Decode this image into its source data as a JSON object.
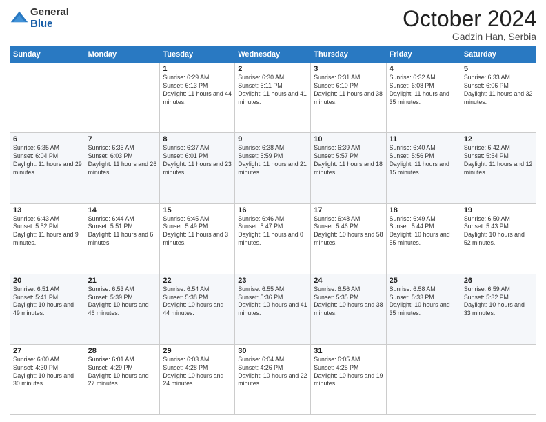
{
  "logo": {
    "general": "General",
    "blue": "Blue"
  },
  "title": {
    "month": "October 2024",
    "location": "Gadzin Han, Serbia"
  },
  "headers": [
    "Sunday",
    "Monday",
    "Tuesday",
    "Wednesday",
    "Thursday",
    "Friday",
    "Saturday"
  ],
  "weeks": [
    [
      {
        "day": "",
        "sunrise": "",
        "sunset": "",
        "daylight": ""
      },
      {
        "day": "",
        "sunrise": "",
        "sunset": "",
        "daylight": ""
      },
      {
        "day": "1",
        "sunrise": "Sunrise: 6:29 AM",
        "sunset": "Sunset: 6:13 PM",
        "daylight": "Daylight: 11 hours and 44 minutes."
      },
      {
        "day": "2",
        "sunrise": "Sunrise: 6:30 AM",
        "sunset": "Sunset: 6:11 PM",
        "daylight": "Daylight: 11 hours and 41 minutes."
      },
      {
        "day": "3",
        "sunrise": "Sunrise: 6:31 AM",
        "sunset": "Sunset: 6:10 PM",
        "daylight": "Daylight: 11 hours and 38 minutes."
      },
      {
        "day": "4",
        "sunrise": "Sunrise: 6:32 AM",
        "sunset": "Sunset: 6:08 PM",
        "daylight": "Daylight: 11 hours and 35 minutes."
      },
      {
        "day": "5",
        "sunrise": "Sunrise: 6:33 AM",
        "sunset": "Sunset: 6:06 PM",
        "daylight": "Daylight: 11 hours and 32 minutes."
      }
    ],
    [
      {
        "day": "6",
        "sunrise": "Sunrise: 6:35 AM",
        "sunset": "Sunset: 6:04 PM",
        "daylight": "Daylight: 11 hours and 29 minutes."
      },
      {
        "day": "7",
        "sunrise": "Sunrise: 6:36 AM",
        "sunset": "Sunset: 6:03 PM",
        "daylight": "Daylight: 11 hours and 26 minutes."
      },
      {
        "day": "8",
        "sunrise": "Sunrise: 6:37 AM",
        "sunset": "Sunset: 6:01 PM",
        "daylight": "Daylight: 11 hours and 23 minutes."
      },
      {
        "day": "9",
        "sunrise": "Sunrise: 6:38 AM",
        "sunset": "Sunset: 5:59 PM",
        "daylight": "Daylight: 11 hours and 21 minutes."
      },
      {
        "day": "10",
        "sunrise": "Sunrise: 6:39 AM",
        "sunset": "Sunset: 5:57 PM",
        "daylight": "Daylight: 11 hours and 18 minutes."
      },
      {
        "day": "11",
        "sunrise": "Sunrise: 6:40 AM",
        "sunset": "Sunset: 5:56 PM",
        "daylight": "Daylight: 11 hours and 15 minutes."
      },
      {
        "day": "12",
        "sunrise": "Sunrise: 6:42 AM",
        "sunset": "Sunset: 5:54 PM",
        "daylight": "Daylight: 11 hours and 12 minutes."
      }
    ],
    [
      {
        "day": "13",
        "sunrise": "Sunrise: 6:43 AM",
        "sunset": "Sunset: 5:52 PM",
        "daylight": "Daylight: 11 hours and 9 minutes."
      },
      {
        "day": "14",
        "sunrise": "Sunrise: 6:44 AM",
        "sunset": "Sunset: 5:51 PM",
        "daylight": "Daylight: 11 hours and 6 minutes."
      },
      {
        "day": "15",
        "sunrise": "Sunrise: 6:45 AM",
        "sunset": "Sunset: 5:49 PM",
        "daylight": "Daylight: 11 hours and 3 minutes."
      },
      {
        "day": "16",
        "sunrise": "Sunrise: 6:46 AM",
        "sunset": "Sunset: 5:47 PM",
        "daylight": "Daylight: 11 hours and 0 minutes."
      },
      {
        "day": "17",
        "sunrise": "Sunrise: 6:48 AM",
        "sunset": "Sunset: 5:46 PM",
        "daylight": "Daylight: 10 hours and 58 minutes."
      },
      {
        "day": "18",
        "sunrise": "Sunrise: 6:49 AM",
        "sunset": "Sunset: 5:44 PM",
        "daylight": "Daylight: 10 hours and 55 minutes."
      },
      {
        "day": "19",
        "sunrise": "Sunrise: 6:50 AM",
        "sunset": "Sunset: 5:43 PM",
        "daylight": "Daylight: 10 hours and 52 minutes."
      }
    ],
    [
      {
        "day": "20",
        "sunrise": "Sunrise: 6:51 AM",
        "sunset": "Sunset: 5:41 PM",
        "daylight": "Daylight: 10 hours and 49 minutes."
      },
      {
        "day": "21",
        "sunrise": "Sunrise: 6:53 AM",
        "sunset": "Sunset: 5:39 PM",
        "daylight": "Daylight: 10 hours and 46 minutes."
      },
      {
        "day": "22",
        "sunrise": "Sunrise: 6:54 AM",
        "sunset": "Sunset: 5:38 PM",
        "daylight": "Daylight: 10 hours and 44 minutes."
      },
      {
        "day": "23",
        "sunrise": "Sunrise: 6:55 AM",
        "sunset": "Sunset: 5:36 PM",
        "daylight": "Daylight: 10 hours and 41 minutes."
      },
      {
        "day": "24",
        "sunrise": "Sunrise: 6:56 AM",
        "sunset": "Sunset: 5:35 PM",
        "daylight": "Daylight: 10 hours and 38 minutes."
      },
      {
        "day": "25",
        "sunrise": "Sunrise: 6:58 AM",
        "sunset": "Sunset: 5:33 PM",
        "daylight": "Daylight: 10 hours and 35 minutes."
      },
      {
        "day": "26",
        "sunrise": "Sunrise: 6:59 AM",
        "sunset": "Sunset: 5:32 PM",
        "daylight": "Daylight: 10 hours and 33 minutes."
      }
    ],
    [
      {
        "day": "27",
        "sunrise": "Sunrise: 6:00 AM",
        "sunset": "Sunset: 4:30 PM",
        "daylight": "Daylight: 10 hours and 30 minutes."
      },
      {
        "day": "28",
        "sunrise": "Sunrise: 6:01 AM",
        "sunset": "Sunset: 4:29 PM",
        "daylight": "Daylight: 10 hours and 27 minutes."
      },
      {
        "day": "29",
        "sunrise": "Sunrise: 6:03 AM",
        "sunset": "Sunset: 4:28 PM",
        "daylight": "Daylight: 10 hours and 24 minutes."
      },
      {
        "day": "30",
        "sunrise": "Sunrise: 6:04 AM",
        "sunset": "Sunset: 4:26 PM",
        "daylight": "Daylight: 10 hours and 22 minutes."
      },
      {
        "day": "31",
        "sunrise": "Sunrise: 6:05 AM",
        "sunset": "Sunset: 4:25 PM",
        "daylight": "Daylight: 10 hours and 19 minutes."
      },
      {
        "day": "",
        "sunrise": "",
        "sunset": "",
        "daylight": ""
      },
      {
        "day": "",
        "sunrise": "",
        "sunset": "",
        "daylight": ""
      }
    ]
  ]
}
